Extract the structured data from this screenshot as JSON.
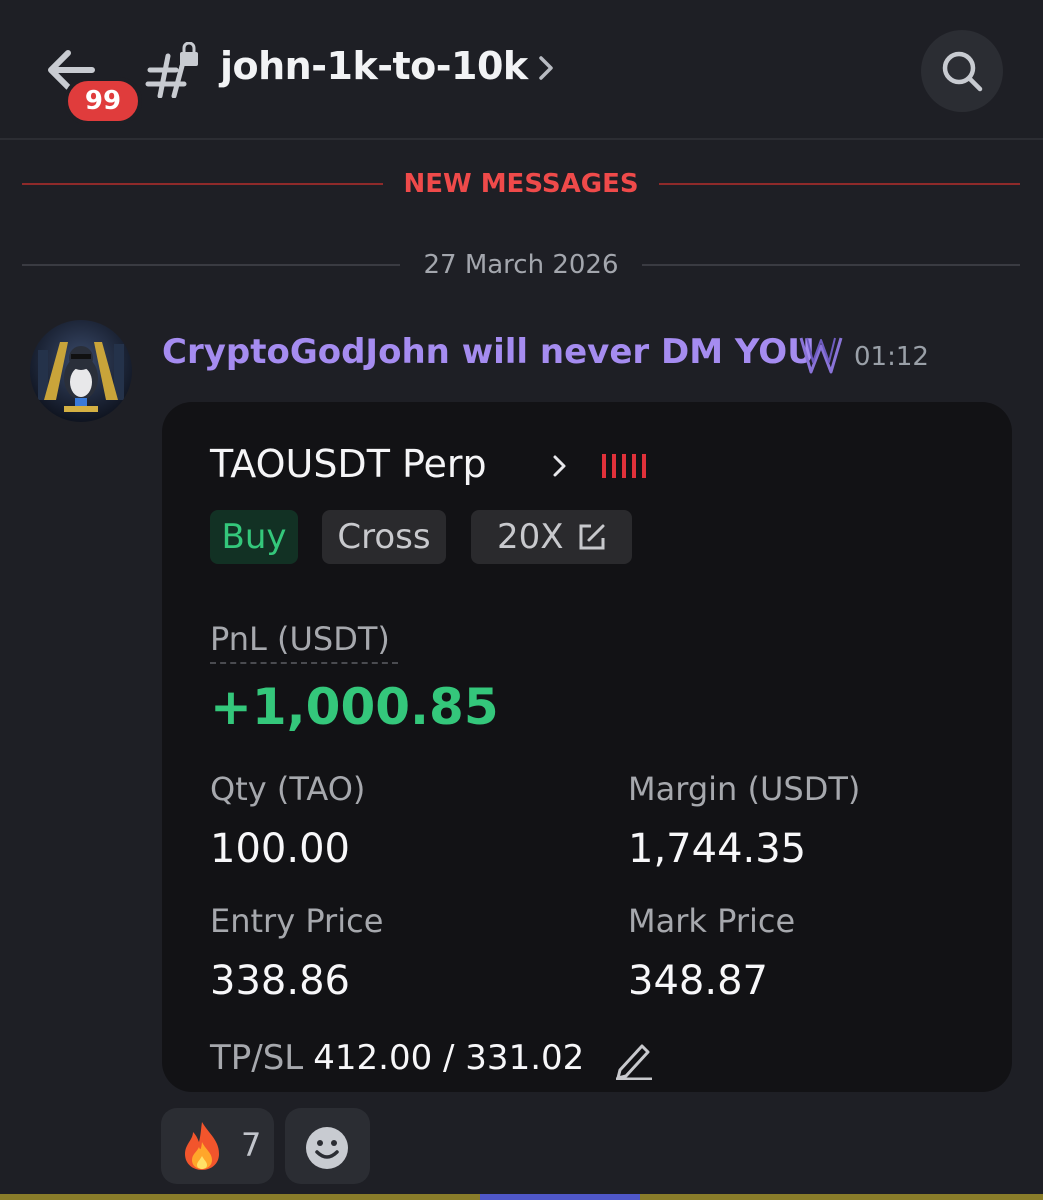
{
  "header": {
    "unread_badge": "99",
    "channel_name": "john-1k-to-10k"
  },
  "dividers": {
    "new_messages": "NEW MESSAGES",
    "date": "27 March 2026"
  },
  "message": {
    "author": "CryptoGodJohn will never DM YOU",
    "timestamp": "01:12"
  },
  "position_card": {
    "pair": "TAOUSDT Perp",
    "side": "Buy",
    "margin_mode": "Cross",
    "leverage": "20X",
    "pnl_label": "PnL (USDT)",
    "pnl_value": "+1,000.85",
    "qty_label": "Qty (TAO)",
    "qty_value": "100.00",
    "margin_label": "Margin (USDT)",
    "margin_value": "1,744.35",
    "entry_label": "Entry Price",
    "entry_value": "338.86",
    "mark_label": "Mark Price",
    "mark_value": "348.87",
    "tpsl_label": "TP/SL",
    "tpsl_value": "412.00 / 331.02"
  },
  "reactions": [
    {
      "emoji": "fire",
      "count": "7"
    }
  ],
  "colors": {
    "background": "#1e1f25",
    "card": "#121215",
    "profit_green": "#34c77b",
    "username": "#a58cf0",
    "new_messages_red": "#ef4a4a",
    "badge_red": "#e03c3c"
  },
  "icons": [
    "back-arrow-icon",
    "hashtag-lock-icon",
    "chevron-right-icon",
    "search-icon",
    "w-badge-icon",
    "edit-icon",
    "pencil-icon",
    "fire-emoji-icon",
    "add-reaction-icon"
  ]
}
